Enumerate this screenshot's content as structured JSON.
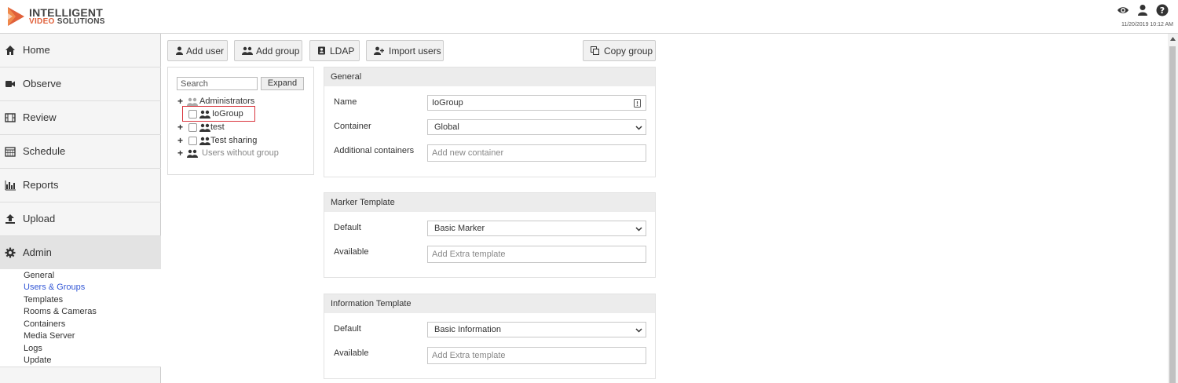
{
  "brand": {
    "line1": "INTELLIGENT",
    "line2a": "VIDEO",
    "line2b": "SOLUTIONS",
    "accent_color": "#e0603a"
  },
  "header": {
    "timestamp": "11/20/2019 10:12 AM",
    "icons": [
      "eye-icon",
      "user-icon",
      "help-icon"
    ]
  },
  "sidebar": {
    "items": [
      {
        "label": "Home",
        "icon": "home-icon"
      },
      {
        "label": "Observe",
        "icon": "video-camera-icon"
      },
      {
        "label": "Review",
        "icon": "film-icon"
      },
      {
        "label": "Schedule",
        "icon": "calendar-icon"
      },
      {
        "label": "Reports",
        "icon": "bar-chart-icon"
      },
      {
        "label": "Upload",
        "icon": "upload-icon"
      },
      {
        "label": "Admin",
        "icon": "gear-icon"
      }
    ],
    "admin_submenu": [
      "General",
      "Users & Groups",
      "Templates",
      "Rooms & Cameras",
      "Containers",
      "Media Server",
      "Logs",
      "Update"
    ],
    "active_submenu": "Users & Groups"
  },
  "toolbar": {
    "add_user": "Add user",
    "add_group": "Add group",
    "ldap": "LDAP",
    "import_users": "Import users",
    "copy_group": "Copy group"
  },
  "tree": {
    "search_placeholder": "Search",
    "expand_label": "Expand",
    "nodes": [
      {
        "label": "Administrators",
        "expandable": true,
        "checkbox": false
      },
      {
        "label": "IoGroup",
        "expandable": false,
        "checkbox": true,
        "selected": true
      },
      {
        "label": "test",
        "expandable": true,
        "checkbox": true
      },
      {
        "label": "Test sharing",
        "expandable": true,
        "checkbox": true
      },
      {
        "label": "Users without group",
        "expandable": true,
        "checkbox": false
      }
    ]
  },
  "general": {
    "title": "General",
    "name_label": "Name",
    "name_value": "IoGroup",
    "container_label": "Container",
    "container_value": "Global",
    "additional_label": "Additional containers",
    "additional_placeholder": "Add new container"
  },
  "marker": {
    "title": "Marker Template",
    "default_label": "Default",
    "default_value": "Basic Marker",
    "available_label": "Available",
    "available_placeholder": "Add Extra template"
  },
  "information": {
    "title": "Information Template",
    "default_label": "Default",
    "default_value": "Basic Information",
    "available_label": "Available",
    "available_placeholder": "Add Extra template"
  }
}
